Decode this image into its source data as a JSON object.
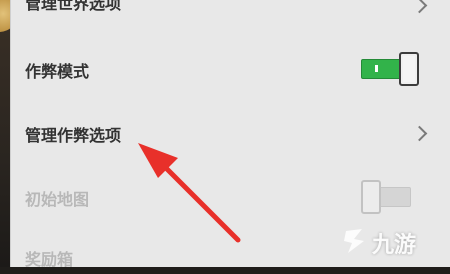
{
  "settings": {
    "items": [
      {
        "label": "管理世界选项",
        "control": "chevron"
      },
      {
        "label": "作弊模式",
        "control": "toggle",
        "state": "on"
      },
      {
        "label": "管理作弊选项",
        "control": "chevron"
      },
      {
        "label": "初始地图",
        "control": "toggle",
        "state": "off",
        "disabled": true
      },
      {
        "label": "奖励箱",
        "control": "none",
        "disabled": true
      }
    ]
  },
  "annotation": {
    "arrow_color": "#e8302a",
    "points_to": "管理作弊选项"
  },
  "watermark": {
    "text": "九游",
    "logo_icon": "jiuyou-logo-icon"
  },
  "colors": {
    "panel_bg": "#e8e8e8",
    "toggle_on": "#32b34a",
    "label_text": "#333333",
    "disabled_text": "#b8b8b8"
  }
}
